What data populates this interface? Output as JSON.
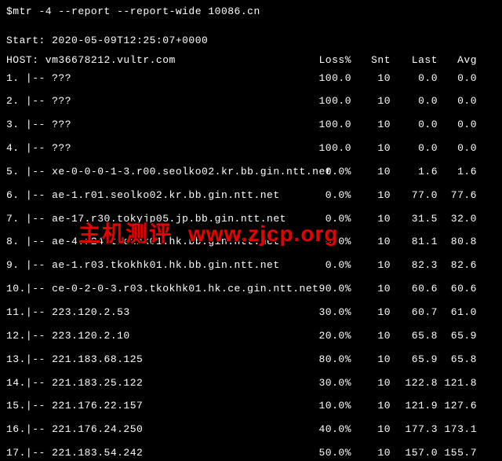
{
  "command": "$mtr -4 --report --report-wide 10086.cn",
  "start_line": "Start: 2020-05-09T12:25:07+0000",
  "host_line_label": "HOST: vm36678212.vultr.com",
  "headers": {
    "loss": "Loss%",
    "snt": "Snt",
    "last": "Last",
    "avg": "Avg"
  },
  "rows": [
    {
      "hop": "1. |-- ???",
      "loss": "100.0",
      "snt": "10",
      "last": "0.0",
      "avg": "0.0"
    },
    {
      "hop": "2. |-- ???",
      "loss": "100.0",
      "snt": "10",
      "last": "0.0",
      "avg": "0.0"
    },
    {
      "hop": "3. |-- ???",
      "loss": "100.0",
      "snt": "10",
      "last": "0.0",
      "avg": "0.0"
    },
    {
      "hop": "4. |-- ???",
      "loss": "100.0",
      "snt": "10",
      "last": "0.0",
      "avg": "0.0"
    },
    {
      "hop": "5. |-- xe-0-0-0-1-3.r00.seolko02.kr.bb.gin.ntt.net",
      "loss": "0.0%",
      "snt": "10",
      "last": "1.6",
      "avg": "1.6"
    },
    {
      "hop": "6. |-- ae-1.r01.seolko02.kr.bb.gin.ntt.net",
      "loss": "0.0%",
      "snt": "10",
      "last": "77.0",
      "avg": "77.6"
    },
    {
      "hop": "7. |-- ae-17.r30.tokyjp05.jp.bb.gin.ntt.net",
      "loss": "0.0%",
      "snt": "10",
      "last": "31.5",
      "avg": "32.0"
    },
    {
      "hop": "8. |-- ae-4.r24.tkokhk01.hk.bb.gin.ntt.net",
      "loss": "0.0%",
      "snt": "10",
      "last": "81.1",
      "avg": "80.8"
    },
    {
      "hop": "9. |-- ae-1.r03.tkokhk01.hk.bb.gin.ntt.net",
      "loss": "0.0%",
      "snt": "10",
      "last": "82.3",
      "avg": "82.6"
    },
    {
      "hop": "10.|-- ce-0-2-0-3.r03.tkokhk01.hk.ce.gin.ntt.net",
      "loss": "90.0%",
      "snt": "10",
      "last": "60.6",
      "avg": "60.6"
    },
    {
      "hop": "11.|-- 223.120.2.53",
      "loss": "30.0%",
      "snt": "10",
      "last": "60.7",
      "avg": "61.0"
    },
    {
      "hop": "12.|-- 223.120.2.10",
      "loss": "20.0%",
      "snt": "10",
      "last": "65.8",
      "avg": "65.9"
    },
    {
      "hop": "13.|-- 221.183.68.125",
      "loss": "80.0%",
      "snt": "10",
      "last": "65.9",
      "avg": "65.8"
    },
    {
      "hop": "14.|-- 221.183.25.122",
      "loss": "30.0%",
      "snt": "10",
      "last": "122.8",
      "avg": "121.8"
    },
    {
      "hop": "15.|-- 221.176.22.157",
      "loss": "10.0%",
      "snt": "10",
      "last": "121.9",
      "avg": "127.6"
    },
    {
      "hop": "16.|-- 221.176.24.250",
      "loss": "40.0%",
      "snt": "10",
      "last": "177.3",
      "avg": "173.1"
    },
    {
      "hop": "17.|-- 221.183.54.242",
      "loss": "50.0%",
      "snt": "10",
      "last": "157.0",
      "avg": "155.7"
    }
  ],
  "watermark": {
    "text_cn": "主机测评",
    "text_url": "www.zjcp.org"
  }
}
